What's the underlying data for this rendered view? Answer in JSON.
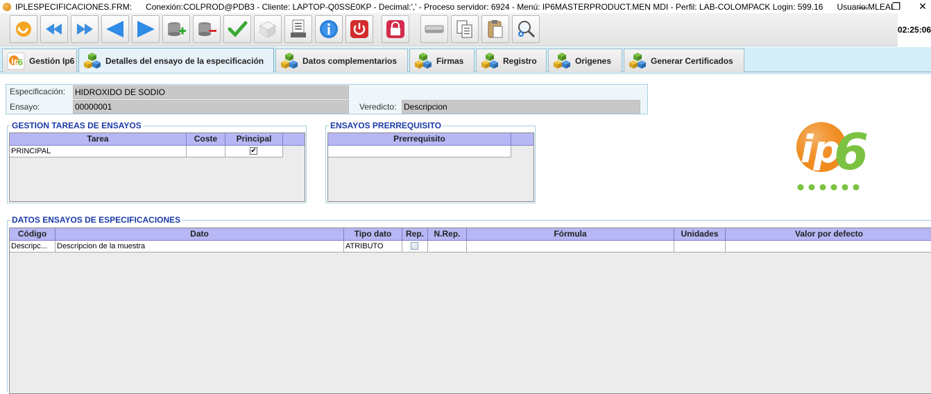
{
  "window": {
    "title": "IPLESPECIFICACIONES.FRM:",
    "connection": "Conexión:COLPROD@PDB3 - Cliente: LAPTOP-Q0SSE0KP - Decimal:',' - Proceso servidor: 6924 - Menú: IP6MASTERPRODUCT.MEN MDI - Perfil: LAB-COLOMPACK Login: 599.16",
    "user": "Usuario:MLEAL",
    "minimize": "—",
    "maximize": "❐",
    "close": "✕"
  },
  "clock": "02:25:06",
  "toolbar": {
    "buttons": [
      "exit-icon",
      "first-record-icon",
      "last-record-icon",
      "previous-record-icon",
      "next-record-icon",
      "add-record-icon",
      "delete-record-icon",
      "accept-icon",
      "cube-icon",
      "print-report-icon",
      "info-icon",
      "shutdown-icon",
      "lock-icon",
      "eraser-icon",
      "copy-icon",
      "paste-icon",
      "search-icon"
    ]
  },
  "tabs": [
    {
      "label": "Gestión Ip6",
      "icon": "ip6-logo-icon"
    },
    {
      "label": "Detalles del ensayo de la especificación",
      "icon": "cubes-icon",
      "active": true
    },
    {
      "label": "Datos complementarios",
      "icon": "cubes-icon"
    },
    {
      "label": "Firmas",
      "icon": "cubes-icon"
    },
    {
      "label": "Registro",
      "icon": "cubes-icon"
    },
    {
      "label": "Origenes",
      "icon": "cubes-icon"
    },
    {
      "label": "Generar Certificados",
      "icon": "cubes-icon"
    }
  ],
  "header": {
    "especificacion_label": "Especificación:",
    "especificacion_value": "HIDROXIDO DE SODIO",
    "ensayo_label": "Ensayo:",
    "ensayo_value": "00000001",
    "veredicto_label": "Veredicto:",
    "veredicto_value": "Descripcion"
  },
  "tareas": {
    "title": "GESTION TAREAS DE ENSAYOS",
    "columns": [
      "Tarea",
      "Coste",
      "Principal"
    ],
    "rows": [
      {
        "tarea": "PRINCIPAL",
        "coste": "",
        "principal": true
      }
    ],
    "check_mark": "✔"
  },
  "prerrequisitos": {
    "title": "ENSAYOS PRERREQUISITO",
    "columns": [
      "Prerrequisito"
    ]
  },
  "datos": {
    "title": "DATOS ENSAYOS DE ESPECIFICACIONES",
    "columns": [
      "Código",
      "Dato",
      "Tipo dato",
      "Rep.",
      "N.Rep.",
      "Fórmula",
      "Unidades",
      "Valor por defecto"
    ],
    "rows": [
      {
        "codigo": "Descripc...",
        "dato": "Descripcion de la muestra",
        "tipo": "ATRIBUTO",
        "rep": false,
        "nrep": "",
        "formula": "",
        "unidades": "",
        "valor": ""
      }
    ]
  },
  "colors": {
    "tab_strip": "#d4eef7",
    "grid_header": "#b7b7f5",
    "group_title": "#1a3aa8",
    "logo_orange": "#f08a1c",
    "logo_green": "#7cc242"
  }
}
